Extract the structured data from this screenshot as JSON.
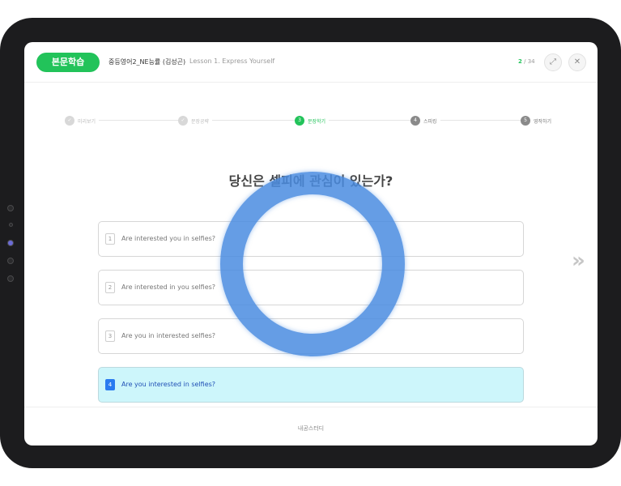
{
  "header": {
    "tag": "본문학습",
    "course": "중등영어2_NE능률 (김성곤)",
    "lesson": "Lesson 1. Express Yourself",
    "page_current": "2",
    "page_total": "/ 34",
    "fullscreen_icon": "⤢",
    "close_icon": "✕"
  },
  "steps": [
    {
      "num": "✓",
      "label": "미리보기",
      "state": "done"
    },
    {
      "num": "✓",
      "label": "문장공략",
      "state": "done"
    },
    {
      "num": "3",
      "label": "문장학기",
      "state": "active"
    },
    {
      "num": "4",
      "label": "스피킹",
      "state": "next"
    },
    {
      "num": "5",
      "label": "영작하기",
      "state": "next"
    }
  ],
  "question": "당신은 셀피에 관심이 있는가?",
  "options": [
    {
      "num": "1",
      "text": "Are interested you in selfies?"
    },
    {
      "num": "2",
      "text": "Are interested in you selfies?"
    },
    {
      "num": "3",
      "text": "Are you in interested selfies?"
    },
    {
      "num": "4",
      "text": "Are you interested in selfies?"
    }
  ],
  "next_arrow": "»",
  "footer": "내공스터디",
  "colors": {
    "accent": "#22c35a",
    "selected_bg": "#cdf6fb",
    "ring": "#4a8ce0"
  }
}
